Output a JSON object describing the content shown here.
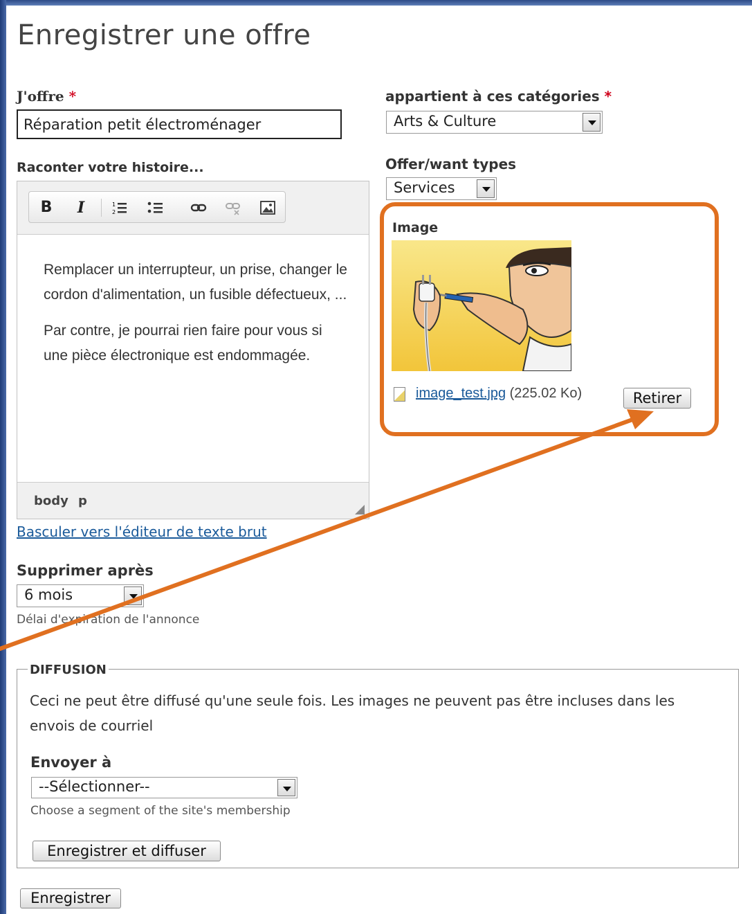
{
  "page_title": "Enregistrer une offre",
  "offer_field": {
    "label": "J'offre",
    "required_mark": "*",
    "value": "Réparation petit électroménager"
  },
  "categories_field": {
    "label": "appartient à ces catégories",
    "required_mark": "*",
    "selected": "Arts & Culture"
  },
  "offer_types_field": {
    "label": "Offer/want types",
    "selected": "Services"
  },
  "story_field": {
    "label": "Raconter votre histoire...",
    "toolbar": [
      "B",
      "I",
      "numbered-list",
      "bulleted-list",
      "link",
      "unlink",
      "image"
    ],
    "paragraphs": [
      "Remplacer un interrupteur, un prise, changer le cordon d'alimentation, un fusible défectueux, ...",
      "Par contre, je pourrai rien faire pour vous si une pièce électronique est endommagée."
    ],
    "path": [
      "body",
      "p"
    ],
    "switch_link": "Basculer vers l'éditeur de texte brut"
  },
  "image_field": {
    "label": "Image",
    "filename": "image_test.jpg",
    "filesize": "(225.02 Ko)",
    "remove_button": "Retirer"
  },
  "expire_field": {
    "label": "Supprimer après",
    "selected": "6 mois",
    "description": "Délai d'expiration de l'annonce"
  },
  "diffusion": {
    "legend": "DIFFUSION",
    "note": "Ceci ne peut être diffusé qu'une seule fois. Les images ne peuvent pas être incluses dans les envois de courriel",
    "send_to_label": "Envoyer à",
    "send_to_selected": "--Sélectionner--",
    "send_to_description": "Choose a segment of the site's membership",
    "save_and_send_button": "Enregistrer et diffuser"
  },
  "save_button": "Enregistrer",
  "annotation_color": "#e07020"
}
